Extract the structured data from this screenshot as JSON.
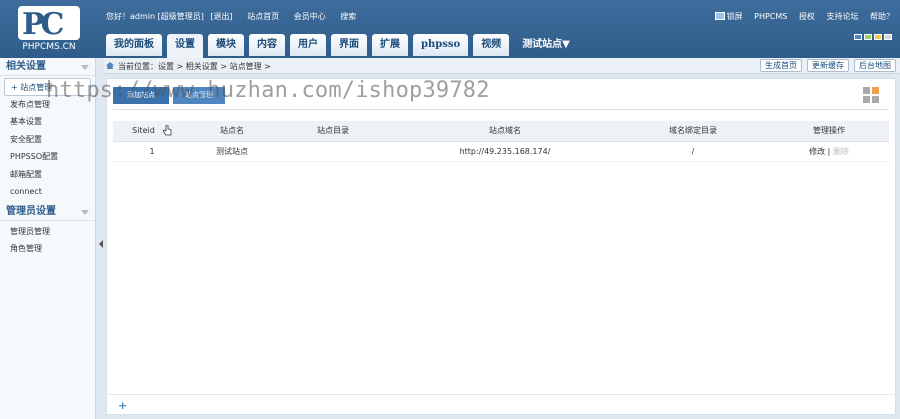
{
  "logo": {
    "text": "PHPCMS.CN"
  },
  "header": {
    "greeting": "您好！admin [超级管理员]",
    "links": [
      "[退出]",
      "站点首页",
      "会员中心",
      "搜索"
    ],
    "right_links": [
      "锁屏",
      "PHPCMS",
      "授权",
      "支持论坛",
      "帮助？"
    ],
    "skin_colors": [
      "#4f86c0",
      "#9bd36b",
      "#f2c94c",
      "#cfd8e3"
    ]
  },
  "tabs": [
    "我的面板",
    "设置",
    "模块",
    "内容",
    "用户",
    "界面",
    "扩展",
    "phpsso",
    "视频",
    "测试站点▼"
  ],
  "sidebar": {
    "section1": "相关设置",
    "items1": [
      "站点管理",
      "发布点管理",
      "基本设置",
      "安全配置",
      "PHPSSO配置",
      "邮箱配置",
      "connect"
    ],
    "section2": "管理员设置",
    "items2": [
      "管理员管理",
      "角色管理"
    ]
  },
  "breadcrumb": "当前位置：设置 > 相关设置 > 站点管理 >",
  "crumb_buttons": [
    "生成首页",
    "更新缓存",
    "后台地图"
  ],
  "toolbar": {
    "add": "添加站点",
    "tab2": "站点管理"
  },
  "table": {
    "headers": [
      "Siteid",
      "站点名",
      "站点目录",
      "站点域名",
      "域名绑定目录",
      "管理操作"
    ],
    "rows": [
      {
        "siteid": "1",
        "name": "测试站点",
        "dir": "",
        "domain": "http://49.235.168.174/",
        "bind": "/",
        "edit": "修改",
        "sep": "|",
        "del": "删除"
      }
    ]
  },
  "footer": {
    "plus": "+"
  },
  "watermark": "https://www.huzhan.com/ishop39782"
}
